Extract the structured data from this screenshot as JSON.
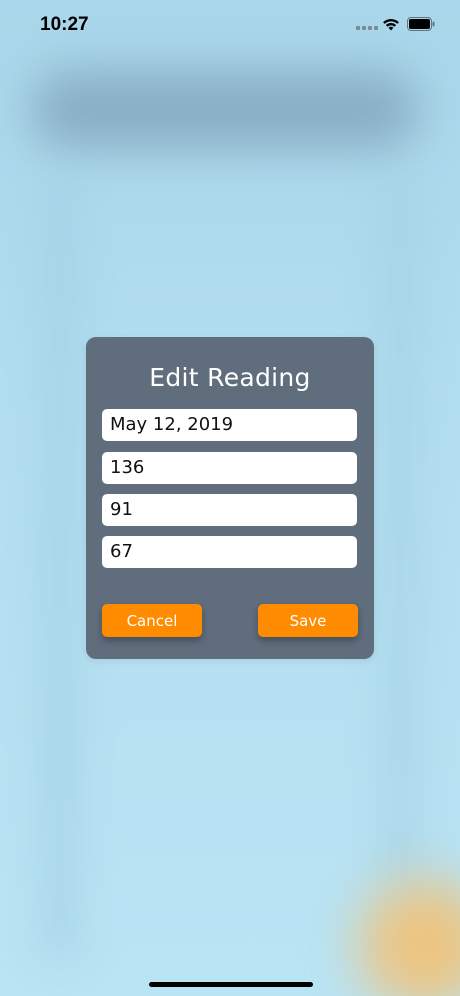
{
  "status_bar": {
    "time": "10:27"
  },
  "dialog": {
    "title": "Edit Reading",
    "fields": {
      "date": "May 12, 2019",
      "systolic": "136",
      "diastolic": "91",
      "pulse": "67"
    },
    "buttons": {
      "cancel_label": "Cancel",
      "save_label": "Save"
    }
  },
  "colors": {
    "background": "#b2def0",
    "dialog_background": "#5f6d7c",
    "button_accent": "#ff8c00",
    "field_background": "#ffffff",
    "text_on_dark": "#ffffff"
  },
  "icons": [
    "cellular-signal-icon",
    "wifi-icon",
    "battery-icon"
  ]
}
